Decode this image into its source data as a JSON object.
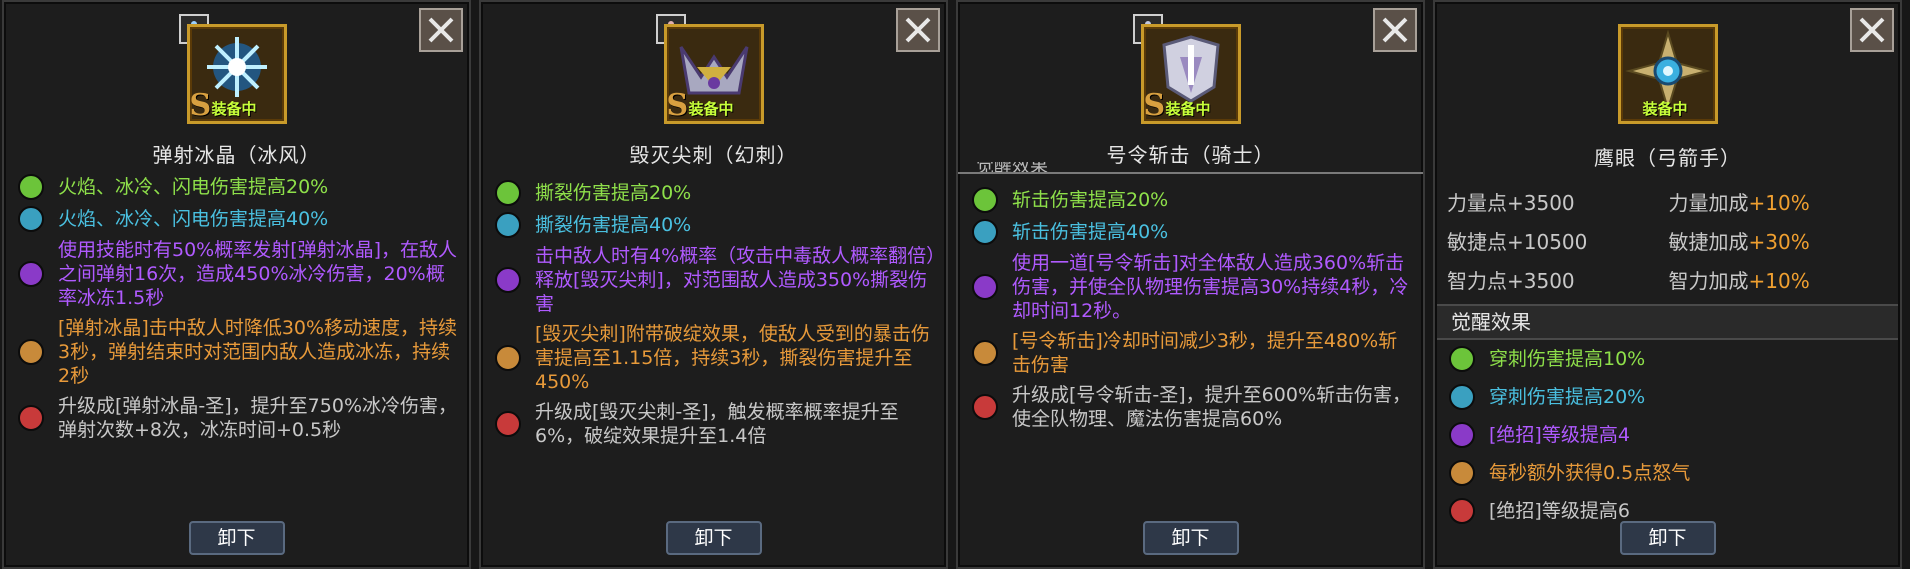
{
  "panels": [
    {
      "name": "弹射冰晶（冰风）",
      "rank": "S",
      "equipped": "装备中",
      "icon": "ice-crystal-icon",
      "effects": [
        {
          "color": "green",
          "text": "火焰、冰冷、闪电伤害提高20%"
        },
        {
          "color": "cyan",
          "text": "火焰、冰冷、闪电伤害提高40%"
        },
        {
          "color": "purple",
          "text": "使用技能时有50%概率发射[弹射冰晶]，在敌人之间弹射16次，造成450%冰冷伤害，20%概率冰冻1.5秒"
        },
        {
          "color": "orange",
          "text": "[弹射冰晶]击中敌人时降低30%移动速度，持续3秒，弹射结束时对范围内敌人造成冰冻，持续2秒"
        },
        {
          "color": "red",
          "text": "升级成[弹射冰晶-圣]，提升至750%冰冷伤害，弹射次数+8次，冰冻时间+0.5秒"
        }
      ],
      "unequip": "卸下"
    },
    {
      "name": "毁灭尖刺（幻刺）",
      "rank": "S",
      "equipped": "装备中",
      "icon": "spike-crown-icon",
      "effects": [
        {
          "color": "green",
          "text": "撕裂伤害提高20%"
        },
        {
          "color": "cyan",
          "text": "撕裂伤害提高40%"
        },
        {
          "color": "purple",
          "text": "击中敌人时有4%概率（攻击中毒敌人概率翻倍）释放[毁灭尖刺]，对范围敌人造成350%撕裂伤害"
        },
        {
          "color": "orange",
          "text": "[毁灭尖刺]附带破绽效果，使敌人受到的暴击伤害提高至1.15倍，持续3秒，撕裂伤害提升至450%"
        },
        {
          "color": "red",
          "text": "升级成[毁灭尖刺-圣]，触发概率概率提升至6%，破绽效果提升至1.4倍"
        }
      ],
      "unequip": "卸下"
    },
    {
      "name": "号令斩击（骑士）",
      "rank": "S",
      "equipped": "装备中",
      "icon": "command-slash-icon",
      "effects": [
        {
          "color": "green",
          "text": "斩击伤害提高20%"
        },
        {
          "color": "cyan",
          "text": "斩击伤害提高40%"
        },
        {
          "color": "purple",
          "text": "使用一道[号令斩击]对全体敌人造成360%斩击伤害，并使全队物理伤害提高30%持续4秒，冷却时间12秒。"
        },
        {
          "color": "orange",
          "text": "[号令斩击]冷却时间减少3秒，提升至480%斩击伤害"
        },
        {
          "color": "red",
          "text": "升级成[号令斩击-圣]，提升至600%斩击伤害，使全队物理、魔法伤害提高60%"
        }
      ],
      "unequip": "卸下"
    },
    {
      "name": "鹰眼（弓箭手）",
      "icon": "eagle-eye-icon",
      "equipped": "装备中",
      "stats": [
        {
          "label": "力量点",
          "value": "+3500",
          "label2": "力量加成",
          "value2": "+10%"
        },
        {
          "label": "敏捷点",
          "value": "+10500",
          "label2": "敏捷加成",
          "value2": "+30%"
        },
        {
          "label": "智力点",
          "value": "+3500",
          "label2": "智力加成",
          "value2": "+10%"
        }
      ],
      "section_title": "觉醒效果",
      "effects": [
        {
          "color": "green",
          "text": "穿刺伤害提高10%"
        },
        {
          "color": "cyan",
          "text": "穿刺伤害提高20%"
        },
        {
          "color": "purple",
          "text": "[绝招]等级提高4"
        },
        {
          "color": "orange",
          "text": "每秒额外获得0.5点怒气"
        },
        {
          "color": "red",
          "text": "[绝招]等级提高6"
        }
      ],
      "unequip": "卸下"
    }
  ],
  "colors": {
    "green": "#8ee04a",
    "cyan": "#4ac0e0",
    "purple": "#b05aff",
    "orange": "#e89a3a",
    "gray": "#c8c8c8",
    "frame_gold": "#c89a2a"
  }
}
